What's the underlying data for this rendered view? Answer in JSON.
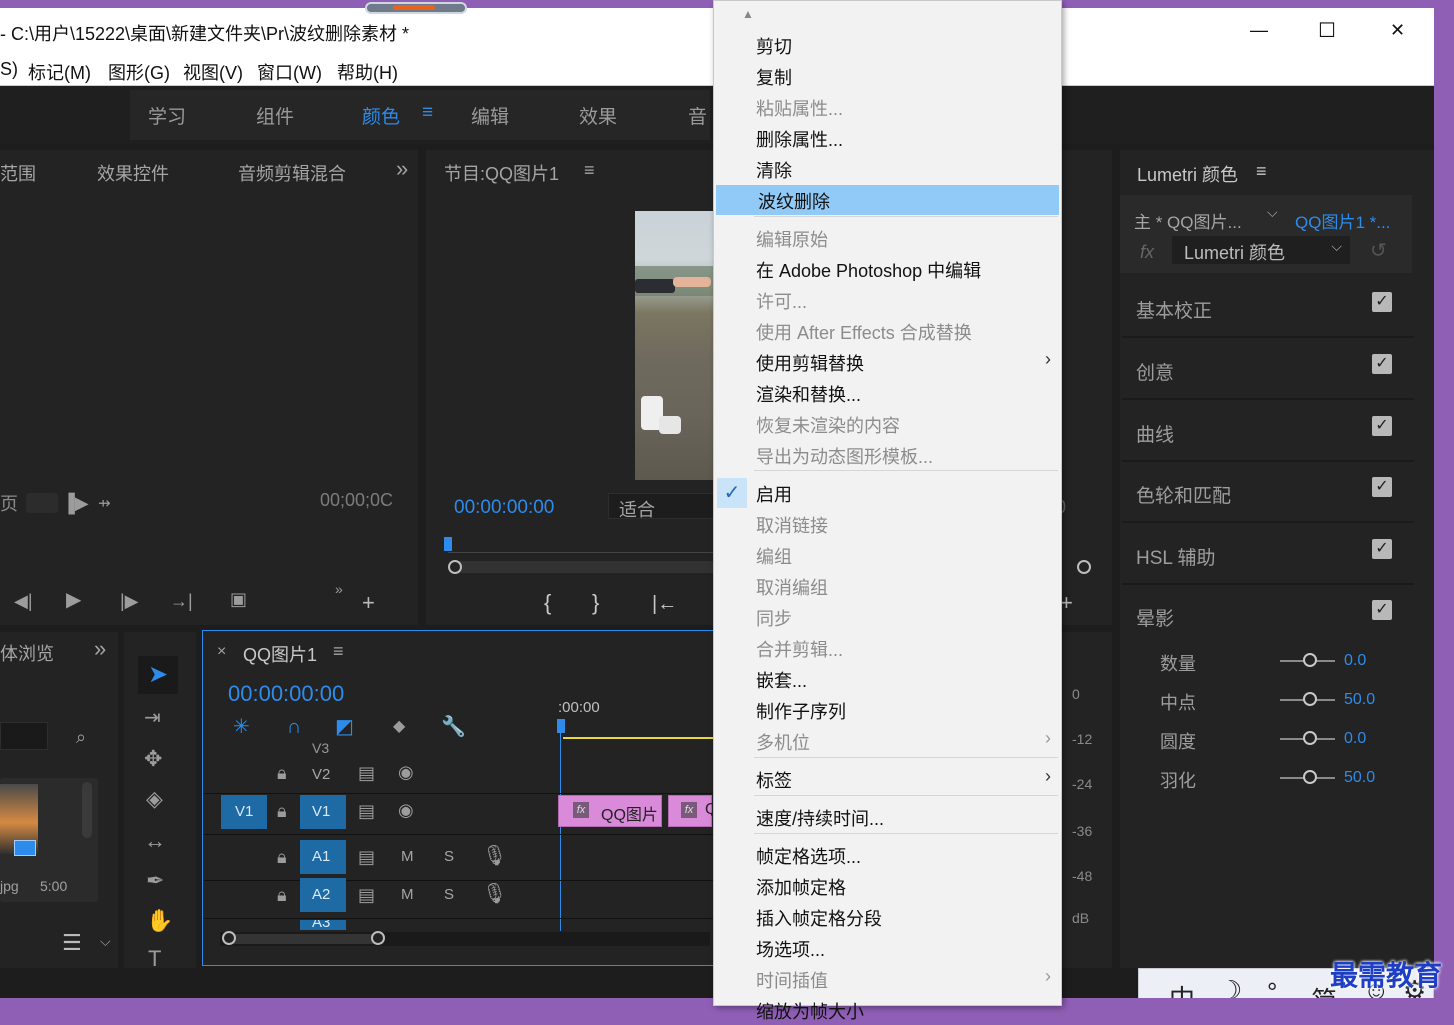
{
  "window": {
    "title": "- C:\\用户\\15222\\桌面\\新建文件夹\\Pr\\波纹删除素材 *",
    "controls": {
      "minimize": "—",
      "maximize": "☐",
      "close": "✕"
    }
  },
  "menubar": {
    "items": [
      "S)",
      "标记(M)",
      "图形(G)",
      "视图(V)",
      "窗口(W)",
      "帮助(H)"
    ]
  },
  "workspaces": {
    "items": [
      "学习",
      "组件",
      "颜色",
      "编辑",
      "效果",
      "音"
    ],
    "active": "颜色"
  },
  "source_panel": {
    "tabs": [
      "范围",
      "效果控件",
      "音频剪辑混合"
    ],
    "more": "»",
    "left_label": "页",
    "timecode": "00;00;0C"
  },
  "program_panel": {
    "title": "节目:QQ图片1",
    "menu": "≡",
    "timecode": "00:00:00:00",
    "fit": "适合",
    "right_digit": "0"
  },
  "project_panel": {
    "tab": "体浏览",
    "more": "»",
    "thumb_name": "jpg",
    "thumb_duration": "5:00"
  },
  "timeline": {
    "close": "×",
    "title": "QQ图片1",
    "menu": "≡",
    "timecode": "00:00:00:00",
    "ruler_time": ":00:00",
    "tracks": {
      "v3": "V3",
      "v2": "V2",
      "v1_source": "V1",
      "v1": "V1",
      "a1": "A1",
      "a2": "A2",
      "a3": "A3",
      "mute": "M",
      "solo": "S"
    },
    "clips": [
      "QQ图片",
      "Q"
    ],
    "fx_badge": "fx"
  },
  "audio_meter": {
    "ticks": [
      "0",
      "-12",
      "-24",
      "-36",
      "-48",
      "dB"
    ]
  },
  "lumetri": {
    "title": "Lumetri 颜色",
    "menu": "≡",
    "master": "主 * QQ图片...",
    "clip": "QQ图片1 *...",
    "fx": "fx",
    "effect": "Lumetri 颜色",
    "sections": [
      "基本校正",
      "创意",
      "曲线",
      "色轮和匹配",
      "HSL 辅助",
      "晕影"
    ],
    "vignette": [
      {
        "label": "数量",
        "value": "0.0"
      },
      {
        "label": "中点",
        "value": "50.0"
      },
      {
        "label": "圆度",
        "value": "0.0"
      },
      {
        "label": "羽化",
        "value": "50.0"
      }
    ]
  },
  "context_menu": {
    "items": [
      {
        "label": "剪切",
        "disabled": false
      },
      {
        "label": "复制",
        "disabled": false
      },
      {
        "label": "粘贴属性...",
        "disabled": true
      },
      {
        "label": "删除属性...",
        "disabled": false
      },
      {
        "label": "清除",
        "disabled": false
      },
      {
        "label": "波纹删除",
        "disabled": false,
        "highlighted": true
      },
      {
        "label": "编辑原始",
        "disabled": true
      },
      {
        "label": "在 Adobe Photoshop 中编辑",
        "disabled": false
      },
      {
        "label": "许可...",
        "disabled": true
      },
      {
        "label": "使用 After Effects 合成替换",
        "disabled": true
      },
      {
        "label": "使用剪辑替换",
        "disabled": false,
        "submenu": true
      },
      {
        "label": "渲染和替换...",
        "disabled": false
      },
      {
        "label": "恢复未渲染的内容",
        "disabled": true
      },
      {
        "label": "导出为动态图形模板...",
        "disabled": true
      },
      {
        "label": "启用",
        "disabled": false,
        "checked": true
      },
      {
        "label": "取消链接",
        "disabled": true
      },
      {
        "label": "编组",
        "disabled": true
      },
      {
        "label": "取消编组",
        "disabled": true
      },
      {
        "label": "同步",
        "disabled": true
      },
      {
        "label": "合并剪辑...",
        "disabled": true
      },
      {
        "label": "嵌套...",
        "disabled": false
      },
      {
        "label": "制作子序列",
        "disabled": false
      },
      {
        "label": "多机位",
        "disabled": true,
        "submenu": true
      },
      {
        "label": "标签",
        "disabled": false,
        "submenu": true
      },
      {
        "label": "速度/持续时间...",
        "disabled": false
      },
      {
        "label": "帧定格选项...",
        "disabled": false
      },
      {
        "label": "添加帧定格",
        "disabled": false
      },
      {
        "label": "插入帧定格分段",
        "disabled": false
      },
      {
        "label": "场选项...",
        "disabled": false
      },
      {
        "label": "时间插值",
        "disabled": true,
        "submenu": true
      },
      {
        "label": "缩放为帧大小",
        "disabled": false
      }
    ],
    "check_glyph": "✓",
    "submenu_glyph": "›",
    "scroll_up": "▲"
  },
  "ime_bar": {
    "items": [
      "中",
      "☽",
      "°,",
      "简",
      "☺",
      "⚙"
    ]
  },
  "watermark": "最需教育",
  "colors": {
    "accent_blue": "#2d8ceb",
    "highlight": "#91c9f7",
    "clip_pink": "#d98ad8",
    "track_blue": "#1d6aa5",
    "desktop_purple": "#8f5fb6"
  }
}
